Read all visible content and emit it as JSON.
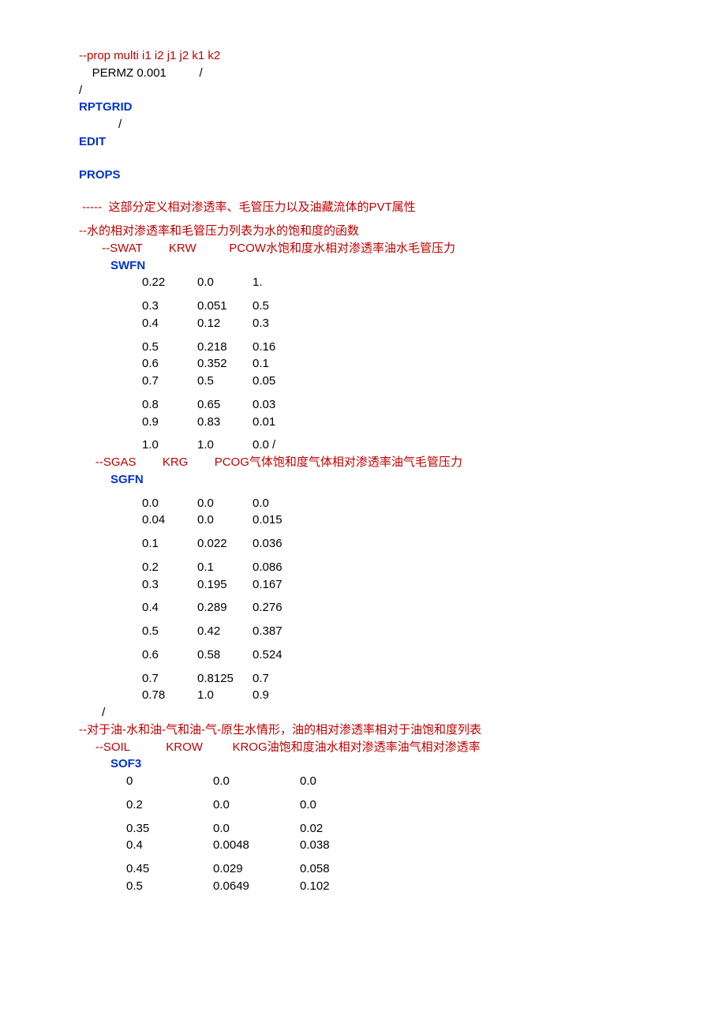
{
  "l1": "--prop multi i1 i2 j1 j2 k1 k2",
  "l2": "    PERMZ 0.001          /",
  "l3": "/",
  "kw_rptgrid": "RPTGRID",
  "l5": "            /",
  "kw_edit": "EDIT",
  "kw_props": "PROPS",
  "c_pvt": " -----  这部分定义相对渗透率、毛管压力以及油藏流体的PVT属性",
  "c_water": "--水的相对渗透率和毛管压力列表为水的饱和度的函数",
  "c_swat": "       --SWAT        KRW          PCOW水饱和度水相对渗透率油水毛管压力",
  "kw_swfn": "SWFN",
  "swfn": [
    {
      "a": "0.22",
      "b": "0.0",
      "c": "1."
    },
    {
      "a": "0.3",
      "b": "0.051",
      "c": "0.5"
    },
    {
      "a": "0.4",
      "b": "0.12",
      "c": "0.3"
    },
    {
      "a": "0.5",
      "b": "0.218",
      "c": "0.16"
    },
    {
      "a": "0.6",
      "b": "0.352",
      "c": "0.1"
    },
    {
      "a": "0.7",
      "b": "0.5",
      "c": "0.05"
    },
    {
      "a": "0.8",
      "b": "0.65",
      "c": "0.03"
    },
    {
      "a": "0.9",
      "b": "0.83",
      "c": "0.01"
    },
    {
      "a": "1.0",
      "b": "1.0",
      "c": "0.0          /"
    }
  ],
  "c_sgas": "     --SGAS        KRG        PCOG气体饱和度气体相对渗透率油气毛管压力",
  "kw_sgfn": "SGFN",
  "sgfn": [
    {
      "a": "0.0",
      "b": "0.0",
      "c": "0.0"
    },
    {
      "a": "0.04",
      "b": "0.0",
      "c": "0.015"
    },
    {
      "a": "0.1",
      "b": "0.022",
      "c": "0.036"
    },
    {
      "a": "0.2",
      "b": "0.1",
      "c": "0.086"
    },
    {
      "a": "0.3",
      "b": "0.195",
      "c": "0.167"
    },
    {
      "a": "0.4",
      "b": "0.289",
      "c": "0.276"
    },
    {
      "a": "0.5",
      "b": "0.42",
      "c": "0.387"
    },
    {
      "a": "0.6",
      "b": "0.58",
      "c": "0.524"
    },
    {
      "a": "0.7",
      "b": "0.8125",
      "c": "0.7"
    },
    {
      "a": "0.78",
      "b": "1.0",
      "c": "0.9"
    }
  ],
  "sgfn_close": "       /",
  "c_oil": "--对于油-水和油-气和油-气-原生水情形，油的相对渗透率相对于油饱和度列表",
  "c_soil": "     --SOIL           KROW         KROG油饱和度油水相对渗透率油气相对渗透率",
  "kw_sof3": "SOF3",
  "sof3": [
    {
      "a": "0",
      "b": "0.0",
      "c": "0.0"
    },
    {
      "a": "0.2",
      "b": "0.0",
      "c": "0.0"
    },
    {
      "a": "0.35",
      "b": "0.0",
      "c": "0.02"
    },
    {
      "a": "0.4",
      "b": "0.0048",
      "c": "0.038"
    },
    {
      "a": "0.45",
      "b": "0.029",
      "c": "0.058"
    },
    {
      "a": "0.5",
      "b": "0.0649",
      "c": "0.102"
    }
  ]
}
